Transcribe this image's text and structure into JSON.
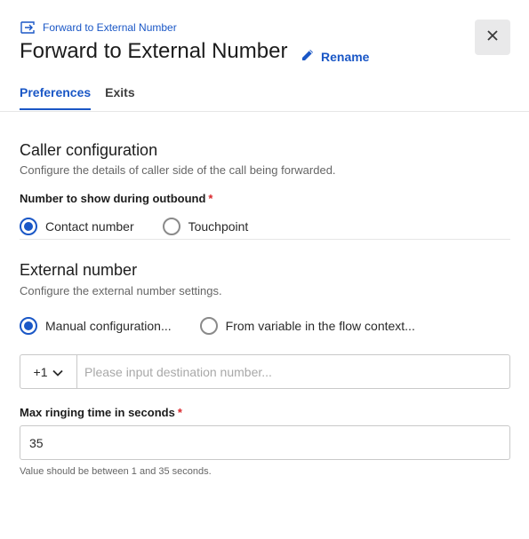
{
  "header": {
    "breadcrumb": "Forward to External Number",
    "breadcrumb_icon": "forward-arrow-icon",
    "title": "Forward to External Number",
    "rename_label": "Rename",
    "rename_icon": "pencil-icon",
    "close_icon": "close-icon"
  },
  "tabs": [
    {
      "label": "Preferences",
      "active": true
    },
    {
      "label": "Exits",
      "active": false
    }
  ],
  "caller_config": {
    "title": "Caller configuration",
    "description": "Configure the details of caller side of the call being forwarded.",
    "field_label": "Number to show during outbound",
    "required_mark": "*",
    "options": [
      {
        "label": "Contact number",
        "checked": true
      },
      {
        "label": "Touchpoint",
        "checked": false
      }
    ]
  },
  "external_number": {
    "title": "External number",
    "description": "Configure the external number settings.",
    "options": [
      {
        "label": "Manual configuration...",
        "checked": true
      },
      {
        "label": "From variable in the flow context...",
        "checked": false
      }
    ],
    "country_code": "+1",
    "phone_value": "",
    "phone_placeholder": "Please input destination number..."
  },
  "ringing": {
    "label": "Max ringing time in seconds",
    "required_mark": "*",
    "value": "35",
    "hint": "Value should be between 1 and 35 seconds."
  },
  "colors": {
    "accent": "#1a57c6",
    "required": "#d9262b"
  }
}
